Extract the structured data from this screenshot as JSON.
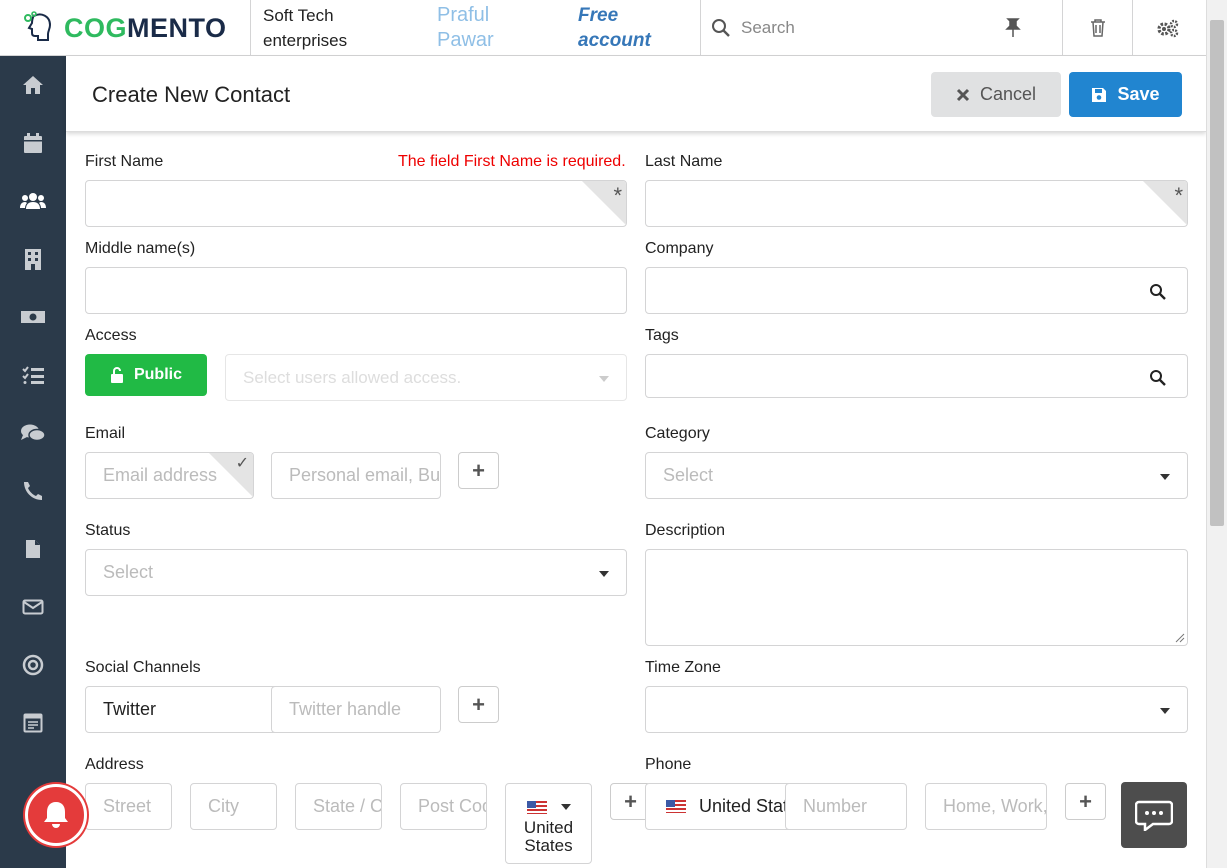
{
  "brand": {
    "name_part1": "COG",
    "name_part2": "MENTO",
    "accent": "#2fba5f"
  },
  "topbar": {
    "company": "Soft Tech enterprises",
    "user": "Praful Pawar",
    "plan": "Free account",
    "search_placeholder": "Search",
    "icons": [
      "pin-icon",
      "trash-icon",
      "settings-icon"
    ]
  },
  "sidebar": {
    "items": [
      "home-icon",
      "calendar-icon",
      "contacts-icon",
      "companies-icon",
      "deals-icon",
      "tasks-icon",
      "cases-icon",
      "calls-icon",
      "documents-icon",
      "email-icon",
      "campaigns-icon",
      "forms-icon"
    ]
  },
  "header": {
    "title": "Create New Contact",
    "cancel_label": "Cancel",
    "save_label": "Save"
  },
  "form": {
    "first_name": {
      "label": "First Name",
      "error": "The field First Name is required.",
      "value": ""
    },
    "last_name": {
      "label": "Last Name",
      "value": ""
    },
    "middle_name": {
      "label": "Middle name(s)",
      "value": ""
    },
    "company": {
      "label": "Company",
      "value": ""
    },
    "access": {
      "label": "Access",
      "button": "Public",
      "users_placeholder": "Select users allowed access."
    },
    "tags": {
      "label": "Tags",
      "value": ""
    },
    "email": {
      "label": "Email",
      "address_placeholder": "Email address",
      "type_placeholder": "Personal email, Business, Alt..."
    },
    "category": {
      "label": "Category",
      "placeholder": "Select"
    },
    "status": {
      "label": "Status",
      "placeholder": "Select"
    },
    "description": {
      "label": "Description",
      "value": ""
    },
    "social": {
      "label": "Social Channels",
      "network": "Twitter",
      "handle_placeholder": "Twitter handle"
    },
    "timezone": {
      "label": "Time Zone",
      "value": ""
    },
    "address": {
      "label": "Address",
      "street": "Street",
      "city": "City",
      "state": "State / County",
      "postcode": "Post Code",
      "country": "United States"
    },
    "phone": {
      "label": "Phone",
      "country": "United States",
      "number_placeholder": "Number",
      "type_placeholder": "Home, Work, Mobile..."
    }
  }
}
